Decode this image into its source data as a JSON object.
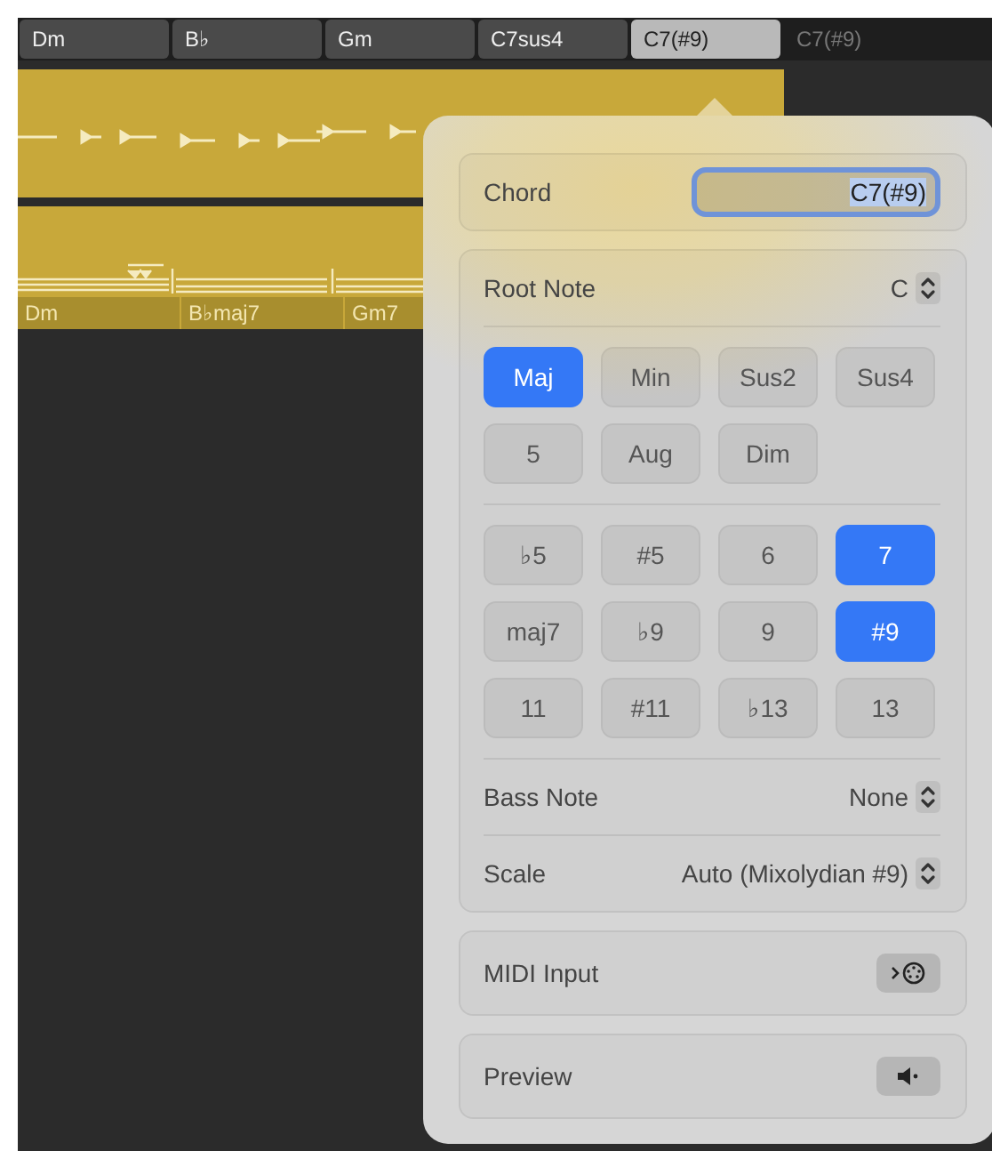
{
  "chord_strip": [
    {
      "label": "Dm",
      "selected": false,
      "dimmed": false
    },
    {
      "label": "B♭",
      "selected": false,
      "dimmed": false
    },
    {
      "label": "Gm",
      "selected": false,
      "dimmed": false
    },
    {
      "label": "C7sus4",
      "selected": false,
      "dimmed": false
    },
    {
      "label": "C7(#9)",
      "selected": true,
      "dimmed": false
    },
    {
      "label": "C7(#9)",
      "selected": false,
      "dimmed": true
    }
  ],
  "chord_region": {
    "labels": [
      "Dm",
      "B♭maj7",
      "Gm7"
    ]
  },
  "popover": {
    "chord": {
      "label": "Chord",
      "value": "C7(#9)"
    },
    "root_note": {
      "label": "Root Note",
      "value": "C"
    },
    "quality_buttons": [
      {
        "label": "Maj",
        "selected": true
      },
      {
        "label": "Min",
        "selected": false
      },
      {
        "label": "Sus2",
        "selected": false
      },
      {
        "label": "Sus4",
        "selected": false
      },
      {
        "label": "5",
        "selected": false
      },
      {
        "label": "Aug",
        "selected": false
      },
      {
        "label": "Dim",
        "selected": false
      }
    ],
    "extension_buttons": [
      {
        "label": "♭5",
        "selected": false
      },
      {
        "label": "#5",
        "selected": false
      },
      {
        "label": "6",
        "selected": false
      },
      {
        "label": "7",
        "selected": true
      },
      {
        "label": "maj7",
        "selected": false
      },
      {
        "label": "♭9",
        "selected": false
      },
      {
        "label": "9",
        "selected": false
      },
      {
        "label": "#9",
        "selected": true
      },
      {
        "label": "11",
        "selected": false
      },
      {
        "label": "#11",
        "selected": false
      },
      {
        "label": "♭13",
        "selected": false
      },
      {
        "label": "13",
        "selected": false
      }
    ],
    "bass_note": {
      "label": "Bass Note",
      "value": "None"
    },
    "scale": {
      "label": "Scale",
      "value": "Auto (Mixolydian #9)"
    },
    "midi_input": {
      "label": "MIDI Input"
    },
    "preview": {
      "label": "Preview"
    }
  }
}
